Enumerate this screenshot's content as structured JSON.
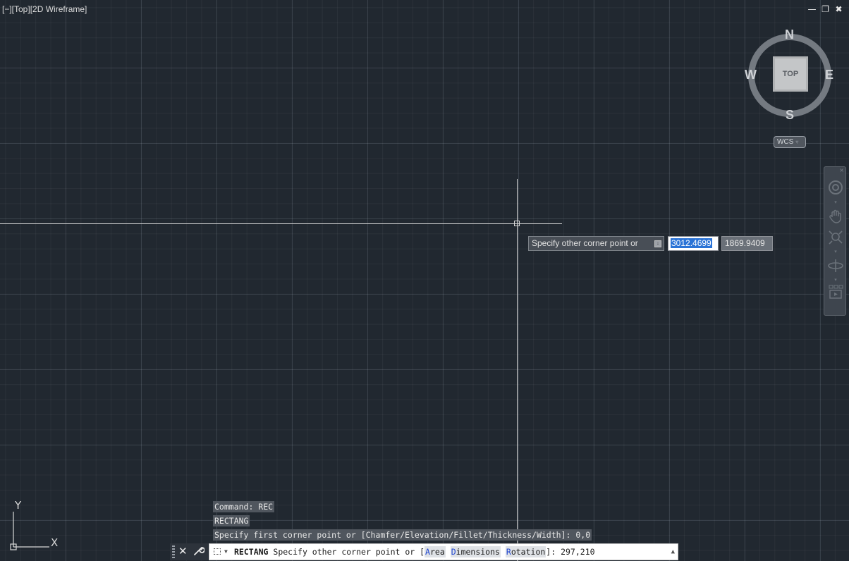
{
  "viewport": {
    "label": "[−][Top][2D Wireframe]",
    "window_controls": [
      "—",
      "❐",
      "✖"
    ]
  },
  "viewcube": {
    "top_face": "TOP",
    "north": "N",
    "south": "S",
    "east": "E",
    "west": "W",
    "wcs_label": "WCS",
    "wcs_caret": "▿"
  },
  "dynamic_input": {
    "prompt": "Specify other corner point or",
    "x_value": "3012.4699",
    "y_value": "1869.9409"
  },
  "ucs": {
    "x_label": "X",
    "y_label": "Y"
  },
  "command_history": [
    "Command: REC",
    "RECTANG",
    "Specify first corner point or [Chamfer/Elevation/Fillet/Thickness/Width]: 0,0"
  ],
  "command_line": {
    "command_name": "RECTANG",
    "prompt": "Specify other corner point or [",
    "options": [
      {
        "hotkey": "A",
        "rest": "rea"
      },
      {
        "hotkey": "D",
        "rest": "imensions"
      },
      {
        "hotkey": "R",
        "rest": "otation"
      }
    ],
    "suffix": "]: ",
    "current_value": "297,210"
  },
  "icons": {
    "close": "close-icon",
    "customize": "wrench-icon",
    "recent": "rectangle-command-icon",
    "navbar": [
      "full-navigation-wheel-icon",
      "pan-icon",
      "zoom-extents-icon",
      "orbit-icon",
      "showmotion-icon"
    ]
  },
  "colors": {
    "background": "#212830",
    "crosshair": "#d8d8d8",
    "selection": "#2a73d6",
    "option_hotkey": "#1f45d0"
  }
}
